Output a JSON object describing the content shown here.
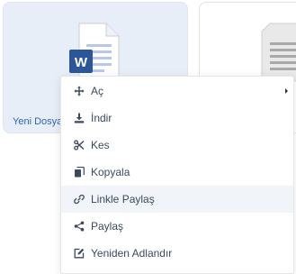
{
  "file": {
    "name": "Yeni Dosya",
    "type_icon": "word-document-icon",
    "accent": "#2b579a"
  },
  "next_file": {
    "type_icon": "text-document-icon"
  },
  "menu": {
    "items": [
      {
        "label": "Aç",
        "icon": "move-arrows-icon",
        "has_submenu": true
      },
      {
        "label": "İndir",
        "icon": "download-icon"
      },
      {
        "label": "Kes",
        "icon": "scissors-icon"
      },
      {
        "label": "Kopyala",
        "icon": "copy-icon"
      },
      {
        "label": "Linkle Paylaş",
        "icon": "link-icon",
        "highlighted": true
      },
      {
        "label": "Paylaş",
        "icon": "share-icon"
      },
      {
        "label": "Yeniden Adlandır",
        "icon": "edit-icon"
      }
    ]
  },
  "colors": {
    "menu_text": "#3b4a5e",
    "hover_bg": "#f1f4f8",
    "card_selected_bg": "#e8eef8",
    "file_name": "#2f63b5"
  }
}
